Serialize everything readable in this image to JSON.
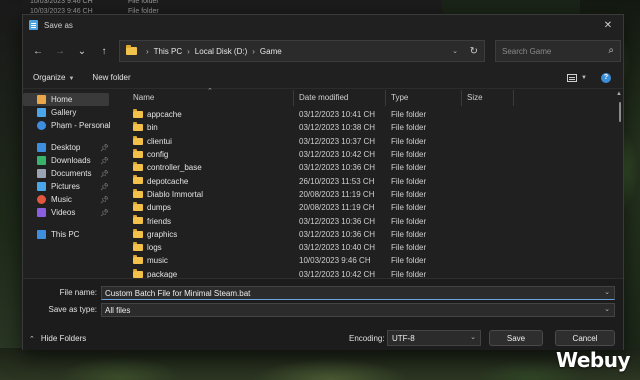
{
  "background": {
    "window_rows": [
      {
        "date": "10/03/2023 9:46 CH",
        "type": "File folder"
      },
      {
        "date": "10/03/2023 9:46 CH",
        "type": "File folder"
      }
    ]
  },
  "dialog": {
    "title": "Save as",
    "close_glyph": "✕"
  },
  "navigation": {
    "back_glyph": "←",
    "forward_glyph": "→",
    "recent_glyph": "⌄",
    "up_glyph": "↑",
    "breadcrumb": [
      "This PC",
      "Local Disk (D:)",
      "Game"
    ],
    "search_placeholder": "Search Game"
  },
  "toolbar": {
    "organize_label": "Organize",
    "new_folder_label": "New folder"
  },
  "sidebar": {
    "items": [
      {
        "label": "Home",
        "icon": "home-icon",
        "color": "#e9a64a"
      },
      {
        "label": "Gallery",
        "icon": "gallery-icon",
        "color": "#4aa6e9"
      },
      {
        "label": "Phạm - Personal",
        "icon": "onedrive-icon",
        "color": "#3e8ee0"
      },
      {
        "label": "Desktop",
        "icon": "desktop-icon",
        "color": "#3e8ee0",
        "pinned": true
      },
      {
        "label": "Downloads",
        "icon": "downloads-icon",
        "color": "#39b36b",
        "pinned": true
      },
      {
        "label": "Documents",
        "icon": "documents-icon",
        "color": "#9aa4b3",
        "pinned": true
      },
      {
        "label": "Pictures",
        "icon": "pictures-icon",
        "color": "#4aa6e9",
        "pinned": true
      },
      {
        "label": "Music",
        "icon": "music-icon",
        "color": "#e0573e",
        "pinned": true
      },
      {
        "label": "Videos",
        "icon": "videos-icon",
        "color": "#8a5ee0",
        "pinned": true
      },
      {
        "label": "This PC",
        "icon": "this-pc-icon",
        "color": "#3e8ee0"
      }
    ]
  },
  "columns": {
    "name": "Name",
    "date_modified": "Date modified",
    "type": "Type",
    "size": "Size"
  },
  "files": [
    {
      "name": "appcache",
      "date": "03/12/2023 10:41 CH",
      "type": "File folder"
    },
    {
      "name": "bin",
      "date": "03/12/2023 10:38 CH",
      "type": "File folder"
    },
    {
      "name": "clientui",
      "date": "03/12/2023 10:37 CH",
      "type": "File folder"
    },
    {
      "name": "config",
      "date": "03/12/2023 10:42 CH",
      "type": "File folder"
    },
    {
      "name": "controller_base",
      "date": "03/12/2023 10:36 CH",
      "type": "File folder"
    },
    {
      "name": "depotcache",
      "date": "26/10/2023 11:53 CH",
      "type": "File folder"
    },
    {
      "name": "Diablo Immortal",
      "date": "20/08/2023 11:19 CH",
      "type": "File folder"
    },
    {
      "name": "dumps",
      "date": "20/08/2023 11:19 CH",
      "type": "File folder"
    },
    {
      "name": "friends",
      "date": "03/12/2023 10:36 CH",
      "type": "File folder"
    },
    {
      "name": "graphics",
      "date": "03/12/2023 10:36 CH",
      "type": "File folder"
    },
    {
      "name": "logs",
      "date": "03/12/2023 10:40 CH",
      "type": "File folder"
    },
    {
      "name": "music",
      "date": "10/03/2023 9:46 CH",
      "type": "File folder"
    },
    {
      "name": "package",
      "date": "03/12/2023 10:42 CH",
      "type": "File folder"
    }
  ],
  "save_panel": {
    "file_name_label": "File name:",
    "file_name_value": "Custom Batch File for Minimal Steam.bat",
    "save_as_type_label": "Save as type:",
    "save_as_type_value": "All files",
    "hide_folders_label": "Hide Folders",
    "encoding_label": "Encoding:",
    "encoding_value": "UTF-8",
    "save_label": "Save",
    "cancel_label": "Cancel"
  },
  "watermark": "Webuy"
}
